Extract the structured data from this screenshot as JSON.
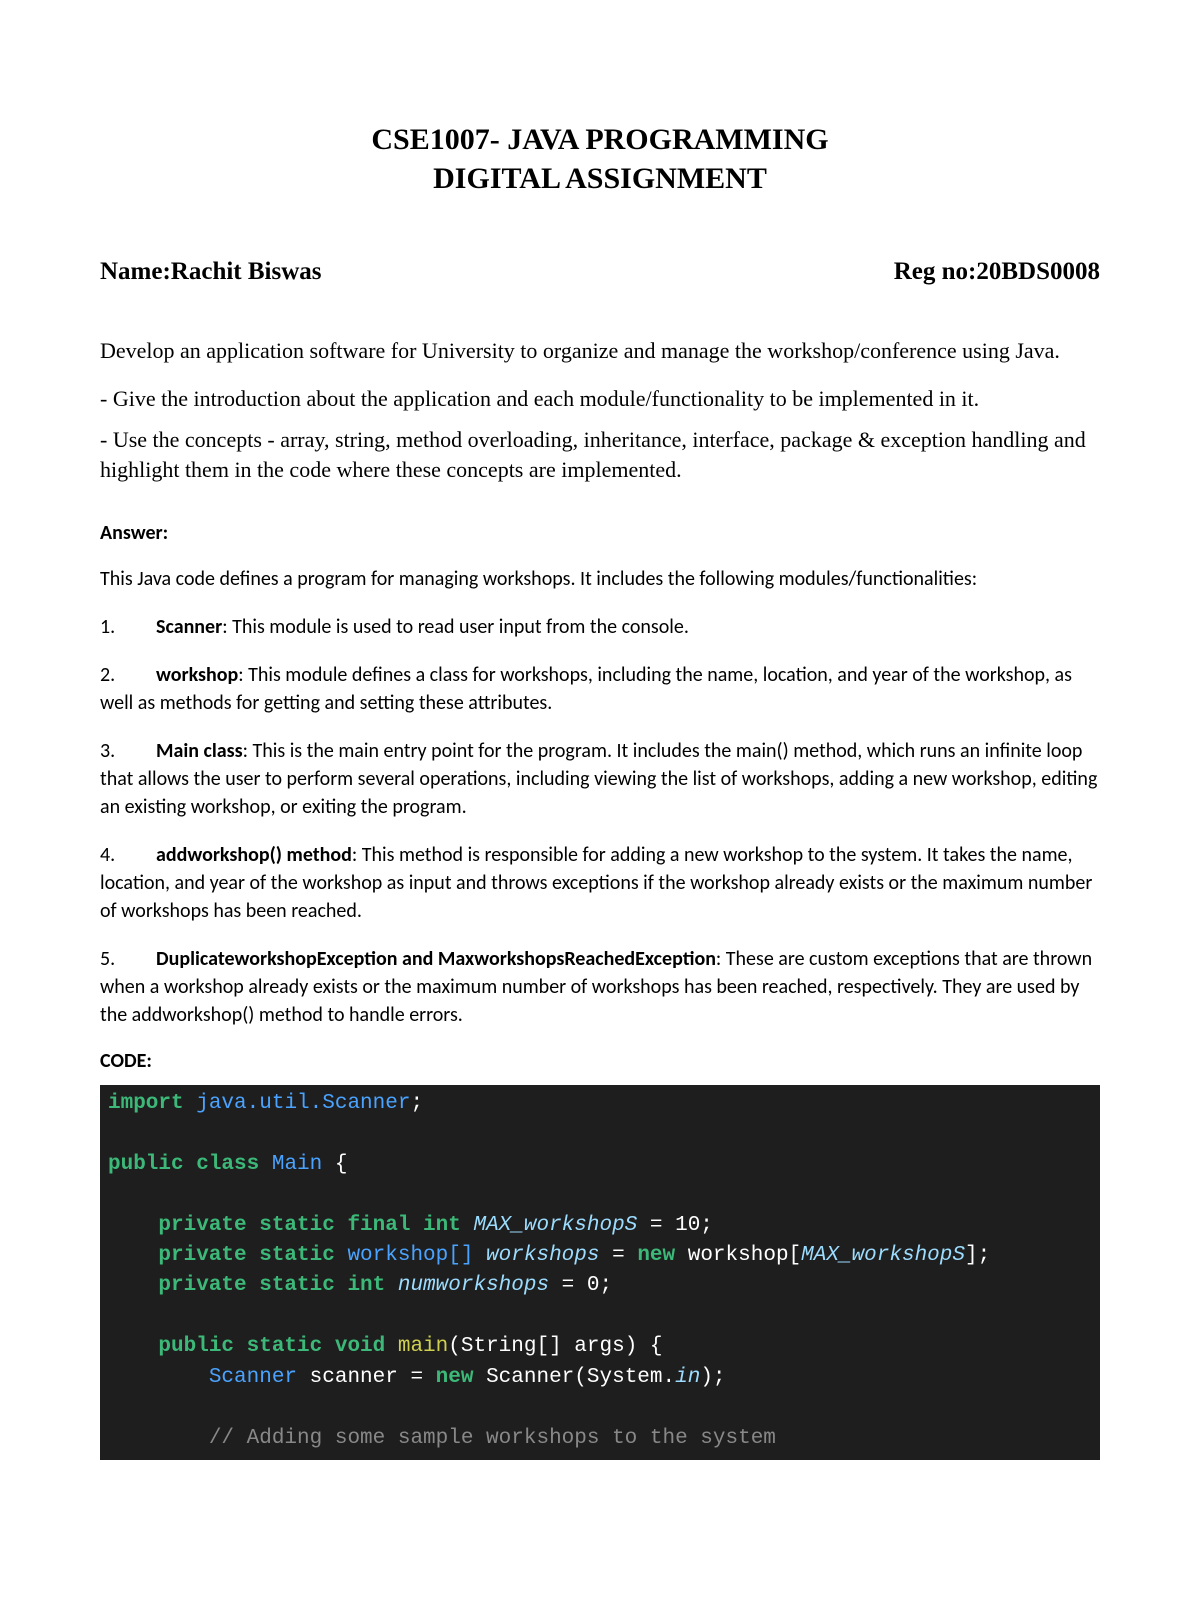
{
  "title": {
    "line1": "CSE1007- JAVA PROGRAMMING",
    "line2": "DIGITAL ASSIGNMENT"
  },
  "student": {
    "name_label": "Name:Rachit Biswas",
    "reg_label": "Reg no:20BDS0008"
  },
  "intro": "Develop an application software for University to organize and manage the workshop/conference using Java.",
  "bullet1": "- Give the introduction about the application and each module/functionality to be implemented in it.",
  "bullet2": "- Use the concepts - array, string, method overloading, inheritance, interface, package & exception handling and highlight them in the code where these concepts are implemented.",
  "answer_label": "Answer:",
  "answer_intro": "This Java code defines a program for managing workshops. It includes the following modules/functionalities:",
  "items": [
    {
      "num": "1.",
      "name": "Scanner",
      "desc": ": This module is used to read user input from the console."
    },
    {
      "num": "2.",
      "name": "workshop",
      "desc": ": This module defines a class for workshops, including the name, location, and year of the workshop, as well as methods for getting and setting these attributes."
    },
    {
      "num": "3.",
      "name": "Main class",
      "desc": ": This is the main entry point for the program. It includes the main() method, which runs an infinite loop that allows the user to perform several operations, including viewing the list of workshops, adding a new workshop, editing an existing workshop, or exiting the program."
    },
    {
      "num": "4.",
      "name": "addworkshop() method",
      "desc": ": This method is responsible for adding a new workshop to the system. It takes the name, location, and year of the workshop as input and throws exceptions if the workshop already exists or the maximum number of workshops has been reached."
    },
    {
      "num": "5.",
      "name": "DuplicateworkshopException and MaxworkshopsReachedException",
      "desc": ": These are custom exceptions that are thrown when a workshop already exists or the maximum number of workshops has been reached, respectively. They are used by the addworkshop() method to handle errors."
    }
  ],
  "code_label": "CODE:",
  "code": {
    "l1": {
      "a": "import",
      "b": " java.util.Scanner",
      "c": ";"
    },
    "l2": {
      "a": "public class",
      "b": " Main",
      "c": " {"
    },
    "l3": {
      "a": "    private static final int",
      "b": " MAX_workshopS",
      "c": " = 10;"
    },
    "l4": {
      "a": "    private static",
      "b": " workshop[]",
      "c": " workshops",
      "d": " = ",
      "e": "new",
      "f": " workshop[",
      "g": "MAX_workshopS",
      "h": "];"
    },
    "l5": {
      "a": "    private static int",
      "b": " numworkshops",
      "c": " = 0;"
    },
    "l6": {
      "a": "    public static void",
      "b": " main",
      "c": "(String[] args) {"
    },
    "l7": {
      "a": "        Scanner",
      "b": " scanner = ",
      "c": "new",
      "d": " Scanner(System.",
      "e": "in",
      "f": ");"
    },
    "l8": {
      "a": "        // Adding some sample workshops to the system"
    }
  }
}
